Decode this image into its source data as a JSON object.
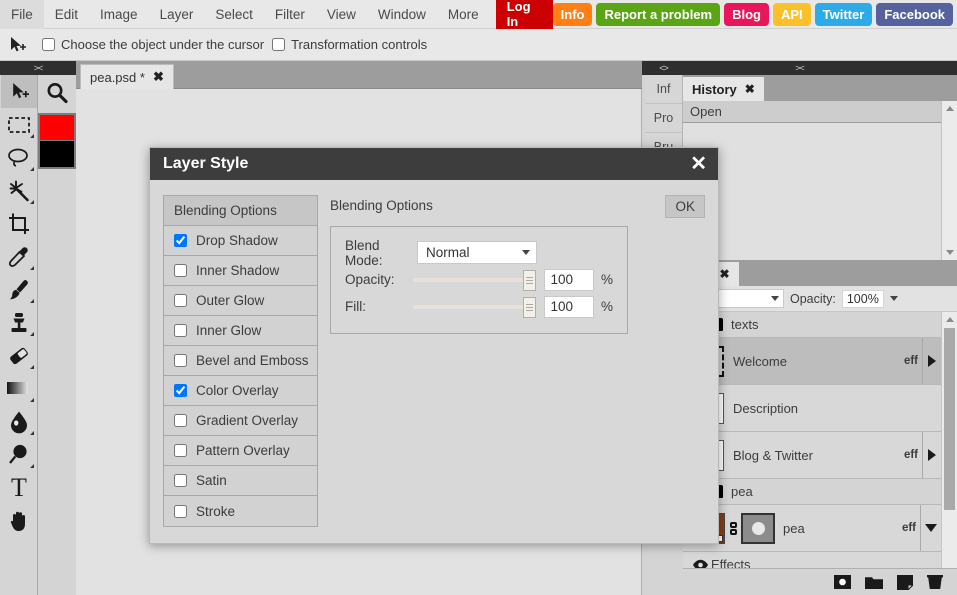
{
  "menubar": {
    "items": [
      "File",
      "Edit",
      "Image",
      "Layer",
      "Select",
      "Filter",
      "View",
      "Window",
      "More"
    ],
    "login_label": "Log In",
    "links": [
      {
        "label": "Info",
        "color": "#ff7f14"
      },
      {
        "label": "Report a problem",
        "color": "#5aa416"
      },
      {
        "label": "Blog",
        "color": "#e8175a"
      },
      {
        "label": "API",
        "color": "#fcc02a"
      },
      {
        "label": "Twitter",
        "color": "#2cabe8"
      },
      {
        "label": "Facebook",
        "color": "#55629e"
      }
    ]
  },
  "options_bar": {
    "tool_icon": "move-tool-icon",
    "checkbox1": {
      "label": "Choose the object under the cursor",
      "checked": false
    },
    "checkbox2": {
      "label": "Transformation controls",
      "checked": false
    }
  },
  "toolbox": {
    "grip": "><",
    "tools": [
      {
        "name": "move-tool",
        "icon": "cursor-plus-icon",
        "active": true
      },
      {
        "name": "marquee-tool",
        "icon": "dashed-rectangle-icon",
        "active": false
      },
      {
        "name": "lasso-tool",
        "icon": "lasso-icon",
        "active": false
      },
      {
        "name": "magic-wand-tool",
        "icon": "magic-wand-icon",
        "active": false
      },
      {
        "name": "crop-tool",
        "icon": "crop-icon",
        "active": false
      },
      {
        "name": "eyedropper-tool",
        "icon": "eyedropper-icon",
        "active": false
      },
      {
        "name": "brush-tool",
        "icon": "paintbrush-icon",
        "active": false
      },
      {
        "name": "stamp-tool",
        "icon": "clone-stamp-icon",
        "active": false
      },
      {
        "name": "eraser-tool",
        "icon": "eraser-icon",
        "active": false
      },
      {
        "name": "gradient-tool",
        "icon": "gradient-icon",
        "active": false
      },
      {
        "name": "blur-tool",
        "icon": "water-drop-icon",
        "active": false
      },
      {
        "name": "dodge-tool",
        "icon": "dodge-icon",
        "active": false
      },
      {
        "name": "type-tool",
        "icon": "text-T-icon",
        "active": false
      },
      {
        "name": "hand-tool",
        "icon": "hand-icon",
        "active": false
      }
    ],
    "zoom_tool": "magnifier-icon",
    "foreground_color": "#ff0000",
    "background_color": "#000000"
  },
  "document": {
    "tab_title": "pea.psd *",
    "close_glyph": "✖"
  },
  "right_dock": {
    "grip": "><",
    "grip_left": "<>",
    "vertical_tabs": [
      "Inf",
      "Pro",
      "Bru"
    ],
    "history": {
      "tab_label": "History",
      "close_glyph": "✖",
      "items": [
        "Open"
      ]
    },
    "layers": {
      "tab_label": "Layers",
      "tab_label_visible": "ers",
      "close_glyph": "✖",
      "blend_mode": "Normal",
      "blend_mode_visible": "rmal",
      "opacity_label": "Opacity:",
      "opacity_value": "100%",
      "rows": [
        {
          "type": "group",
          "name": "texts",
          "eff": "",
          "expanded": true
        },
        {
          "type": "text",
          "name": "Welcome",
          "eff": "eff",
          "selected": true,
          "caret": "right"
        },
        {
          "type": "text",
          "name": "Description",
          "eff": "",
          "selected": false,
          "caret": ""
        },
        {
          "type": "text",
          "name": "Blog & Twitter",
          "eff": "eff",
          "selected": false,
          "caret": "right"
        },
        {
          "type": "group",
          "name": "pea",
          "eff": "",
          "expanded": true
        },
        {
          "type": "image",
          "name": "pea",
          "eff": "eff",
          "selected": false,
          "caret": "down"
        },
        {
          "type": "effects",
          "name": "Effects",
          "eff": "",
          "selected": false,
          "caret": ""
        }
      ],
      "footer_icons": [
        "new-adjustment-layer-icon",
        "new-group-icon",
        "new-layer-icon",
        "delete-layer-icon"
      ]
    }
  },
  "dialog": {
    "title": "Layer Style",
    "close_glyph": "✕",
    "ok_label": "OK",
    "section_title": "Blending Options",
    "effects": [
      {
        "label": "Blending Options",
        "type": "header",
        "checked": null
      },
      {
        "label": "Drop Shadow",
        "type": "check",
        "checked": true
      },
      {
        "label": "Inner Shadow",
        "type": "check",
        "checked": false
      },
      {
        "label": "Outer Glow",
        "type": "check",
        "checked": false
      },
      {
        "label": "Inner Glow",
        "type": "check",
        "checked": false
      },
      {
        "label": "Bevel and Emboss",
        "type": "check",
        "checked": false
      },
      {
        "label": "Color Overlay",
        "type": "check",
        "checked": true
      },
      {
        "label": "Gradient Overlay",
        "type": "check",
        "checked": false
      },
      {
        "label": "Pattern Overlay",
        "type": "check",
        "checked": false
      },
      {
        "label": "Satin",
        "type": "check",
        "checked": false
      },
      {
        "label": "Stroke",
        "type": "check",
        "checked": false
      }
    ],
    "blend_mode_label": "Blend Mode:",
    "blend_mode_value": "Normal",
    "opacity_label": "Opacity:",
    "opacity_value": "100",
    "opacity_unit": "%",
    "fill_label": "Fill:",
    "fill_value": "100",
    "fill_unit": "%"
  }
}
